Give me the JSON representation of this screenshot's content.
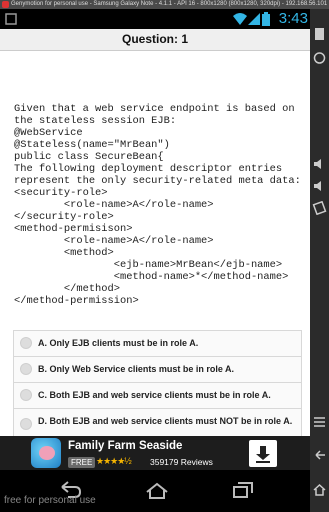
{
  "window": {
    "title": "Genymotion for personal use - Samsung Galaxy Note - 4.1.1 - API 16 - 800x1280 (800x1280, 320dpi) - 192.168.56.101"
  },
  "statusbar": {
    "time": "3:43"
  },
  "question": {
    "header": "Question: 1",
    "text": "Given that a web service endpoint is based on\nthe stateless session EJB:\n@WebService\n@Stateless(name=\"MrBean\")\npublic class SecureBean{\nThe following deployment descriptor entries\nrepresent the only security-related meta data:\n<security-role>\n        <role-name>A</role-name>\n</security-role>\n<method-permisison>\n        <role-name>A</role-name>\n        <method>\n                <ejb-name>MrBean</ejb-name>\n                <method-name>*</method-name>\n        </method>\n</method-permission>"
  },
  "options": [
    {
      "label": "A. Only EJB clients must be in role A."
    },
    {
      "label": "B. Only Web Service clients must be in role A."
    },
    {
      "label": "C. Both EJB and web service clients must be in role A."
    },
    {
      "label": "D. Both EJB and web service clients must NOT be in role A."
    }
  ],
  "ad": {
    "app_name": "Family Farm Seaside",
    "badge": "FREE",
    "stars": "★★★★½",
    "reviews": "359179 Reviews"
  },
  "watermark": "free for personal use",
  "icons": [
    "close-icon",
    "notification-icon",
    "wifi-icon",
    "signal-icon",
    "battery-icon",
    "back-icon",
    "home-icon",
    "recent-apps-icon",
    "download-icon",
    "gps-icon",
    "volume-up-icon",
    "volume-down-icon",
    "rotate-icon"
  ]
}
